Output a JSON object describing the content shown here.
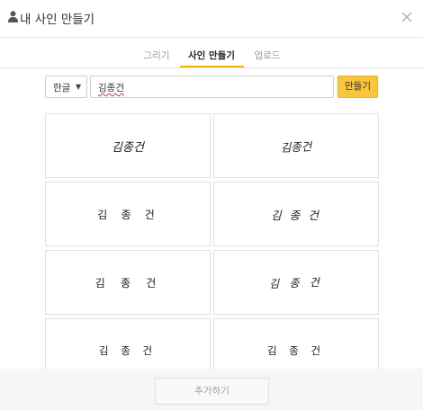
{
  "dialog": {
    "title": "내 사인 만들기",
    "person_icon": "person-icon",
    "close_icon": "close-icon"
  },
  "tabs": [
    {
      "label": "그리기",
      "active": false
    },
    {
      "label": "사인 만들기",
      "active": true
    },
    {
      "label": "업로드",
      "active": false
    }
  ],
  "form": {
    "language": {
      "selected": "한글",
      "caret_icon": "caret-down-icon"
    },
    "name_input": {
      "value": "김종건"
    },
    "make_button": "만들기"
  },
  "signatures": [
    "김종건",
    "김종건",
    "김 종 건",
    "김 종 건",
    "김 종 건",
    "김 종 건",
    "김 종 건",
    "김 종 건"
  ],
  "footer": {
    "add_button": "추가하기"
  },
  "colors": {
    "accent": "#f5b800",
    "make_button_bg": "#f9c53a"
  }
}
